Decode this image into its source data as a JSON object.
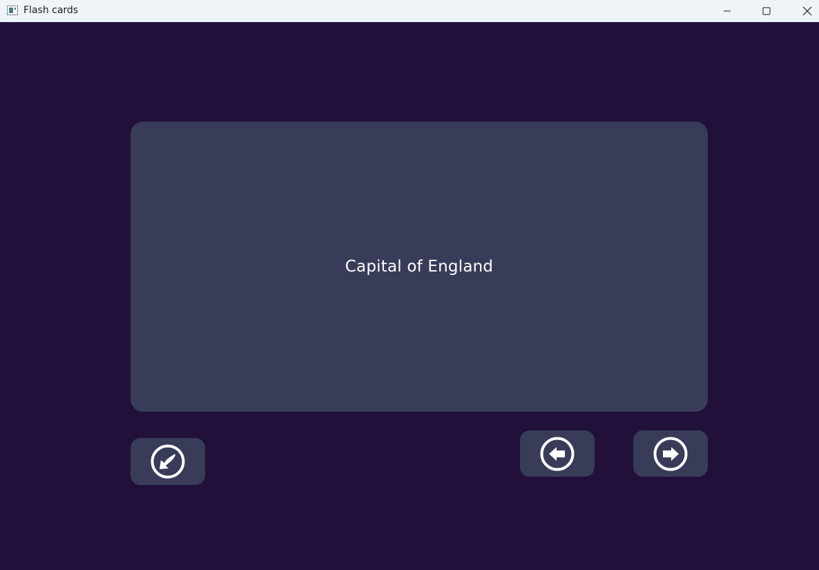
{
  "window": {
    "title": "Flash cards",
    "app_icon": "app-window-icon",
    "controls": {
      "minimize_icon": "minimize-icon",
      "maximize_icon": "maximize-icon",
      "close_icon": "close-icon"
    }
  },
  "card": {
    "text": "Capital of England"
  },
  "buttons": {
    "back_icon": "return-arrow-icon",
    "prev_icon": "arrow-left-circle-icon",
    "next_icon": "arrow-right-circle-icon"
  },
  "colors": {
    "background": "#21113a",
    "card": "#383c58",
    "titlebar": "#eff4f9",
    "text": "#ffffff"
  }
}
